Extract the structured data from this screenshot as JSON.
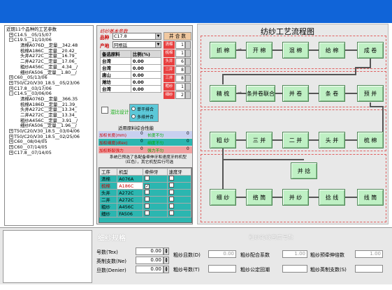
{
  "tree": {
    "root": "近期11个品种的工艺参数",
    "items": [
      {
        "level": 1,
        "box": "+",
        "text": "C14.5__05/15/07"
      },
      {
        "level": 1,
        "box": "-",
        "text": "C19.5__11/10/06"
      },
      {
        "level": 2,
        "box": "",
        "text": "清棉A076D__定量__342.48"
      },
      {
        "level": 2,
        "box": "",
        "text": "梳棉A186C__定量__20.42_"
      },
      {
        "level": 2,
        "box": "",
        "text": "头并A272C__定量__16.79_"
      },
      {
        "level": 2,
        "box": "",
        "text": "二并A272C__定量__17.06_"
      },
      {
        "level": 2,
        "box": "",
        "text": "粗纱A456C__定量__4.34__/"
      },
      {
        "level": 2,
        "box": "",
        "text": "细纱FA506__定量__1.80__/"
      },
      {
        "level": 1,
        "box": "+",
        "text": "C60__05/13/06"
      },
      {
        "level": 1,
        "box": "+",
        "text": "T50/C20/V30_18.5__05/23/06"
      },
      {
        "level": 1,
        "box": "+",
        "text": "C17.8__03/17/06"
      },
      {
        "level": 1,
        "box": "-",
        "text": "C14.5__03/06/06"
      },
      {
        "level": 2,
        "box": "",
        "text": "清棉A076D__定量__366.35"
      },
      {
        "level": 2,
        "box": "",
        "text": "梳棉A186D__定量__21.39_"
      },
      {
        "level": 2,
        "box": "",
        "text": "头并A272C__定量__13.34_"
      },
      {
        "level": 2,
        "box": "",
        "text": "二并A272C__定量__13.34_"
      },
      {
        "level": 2,
        "box": "",
        "text": "粗纱A456C__定量__3.91__/"
      },
      {
        "level": 2,
        "box": "",
        "text": "细纱FA506__定量__1.96__/"
      },
      {
        "level": 1,
        "box": "+",
        "text": "T50/C20/V30_18.5__03/04/06"
      },
      {
        "level": 1,
        "box": "+",
        "text": "T50/C20/V30_18.5__02/25/06"
      },
      {
        "level": 1,
        "box": "+",
        "text": "C60__08/04/05"
      },
      {
        "level": 1,
        "box": "+",
        "text": "C60__07/14/05"
      },
      {
        "level": 1,
        "box": "+",
        "text": "C17.8__07/14/05"
      }
    ]
  },
  "left": {
    "section_title": "纺纱基本参数",
    "variety_label": "品种",
    "variety_value": "C17.8",
    "origin_label": "产地",
    "origin_value": "阿根廷",
    "table_headers": [
      "备选原料",
      "比例(%)"
    ],
    "materials": [
      {
        "name": "台湾",
        "pct": "0.00"
      },
      {
        "name": "台湾",
        "pct": "0.00"
      },
      {
        "name": "唐山",
        "pct": "0.00"
      },
      {
        "name": "潍坊",
        "pct": "0.00"
      },
      {
        "name": "台湾",
        "pct": "0.00"
      }
    ],
    "merge_title": "并 合 数",
    "merge_rows": [
      {
        "label": "清棉",
        "value": "1"
      },
      {
        "label": "梳棉",
        "value": "1"
      },
      {
        "label": "头并",
        "value": "6"
      },
      {
        "label": "二并",
        "value": "8"
      },
      {
        "label": "三并",
        "value": "8"
      },
      {
        "label": "粗纱",
        "value": "1"
      },
      {
        "label": "细纱",
        "value": "2"
      }
    ],
    "checkbox_label": "混比设计",
    "radio_single": "单干排合",
    "radio_multi": "多排并合",
    "perf_title": "适用原料综合性能",
    "perf_rows": [
      {
        "l1": "加权长度(mm)",
        "v1": "0",
        "l2": "长度不匀",
        "v2": "0"
      },
      {
        "l1": "加权细度(dtex)",
        "v1": "0",
        "l2": "细度不匀",
        "v2": "0"
      },
      {
        "l1": "加权断裂强力",
        "v1": "0",
        "l2": "强力不匀",
        "v2": "0"
      }
    ],
    "note": "系统已预选了各配备牵伸牙和速度牙的机型（红色），其它机型后行可选",
    "machine_headers": [
      "工序",
      "机型",
      "牵伸牙",
      "速度牙"
    ],
    "machines": [
      {
        "proc": "清棉",
        "model": "A076A",
        "c1": false,
        "c2": false
      },
      {
        "proc": "梳棉",
        "model": "A186C",
        "c1": true,
        "c2": false
      },
      {
        "proc": "头并",
        "model": "A272C",
        "c1": false,
        "c2": false
      },
      {
        "proc": "二并",
        "model": "A272C",
        "c1": false,
        "c2": false
      },
      {
        "proc": "粗纱",
        "model": "A456C",
        "c1": false,
        "c2": false
      },
      {
        "proc": "细纱",
        "model": "FA506",
        "c1": false,
        "c2": false
      }
    ]
  },
  "flow": {
    "title": "纺纱工艺流程图",
    "row1": [
      "抓 棉",
      "开 棉",
      "混 棉",
      "给 棉",
      "成 卷"
    ],
    "row2": [
      "精 梳",
      "条并卷联合",
      "并 卷",
      "条 卷",
      "预 并"
    ],
    "row3": [
      "粗 纱",
      "三 并",
      "二 并",
      "头 并",
      "梳 棉"
    ],
    "row4_top": "并 捻",
    "row4": [
      "细 纱",
      "络 筒",
      "并 纱",
      "捻 线",
      "线 筒"
    ],
    "arrow": "⇒"
  },
  "bottom": {
    "section_left_title": "细纱规格",
    "section_mid_title": "粗纱的线密度号数",
    "fields_left": [
      {
        "label": "号数(Tex)",
        "value": "0.00"
      },
      {
        "label": "英制支数(Ne)",
        "value": "0.00"
      },
      {
        "label": "旦数(Denier)",
        "value": "0.00"
      }
    ],
    "mid": {
      "sliver_tex_label": "粗纱且数(D)",
      "sliver_tex_value": "0.00",
      "sliver_draft_label": "粗纱配合系数",
      "sliver_draft_value": "1.00",
      "rove_pre_label": "粗纱预牵伸倍数",
      "rove_pre_value": "1.00",
      "sliver_num_label": "粗纱号数(T)",
      "twist_label": "粗纱公定回潮",
      "rove_count_label": "粗纱英制支数(S)"
    }
  }
}
